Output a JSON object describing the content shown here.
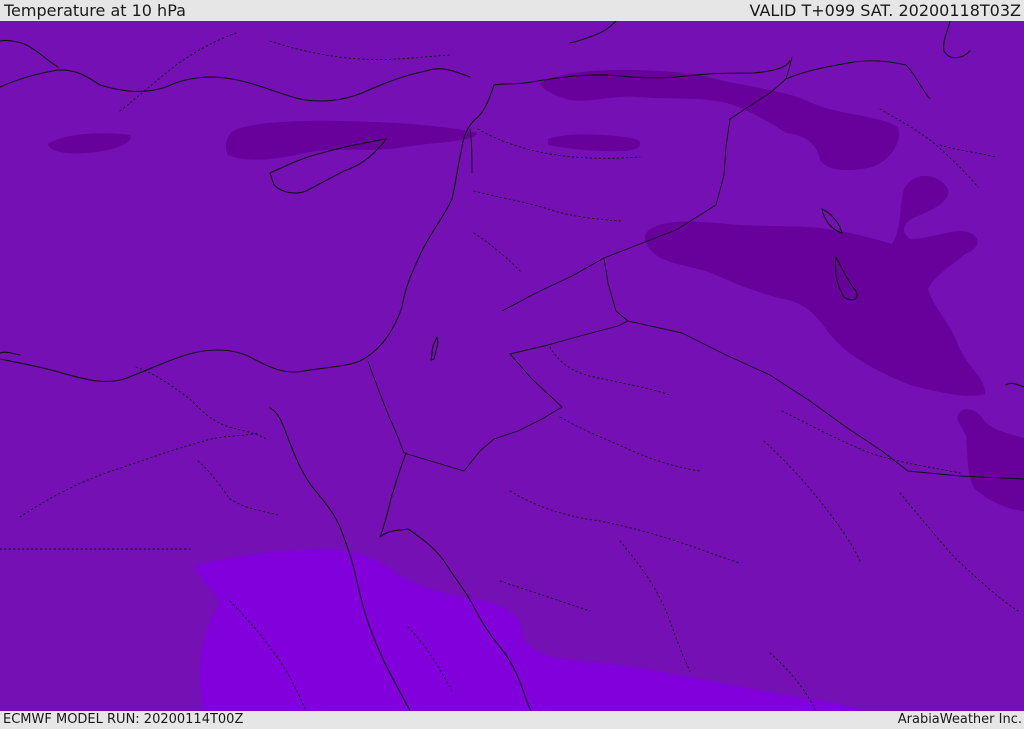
{
  "header": {
    "title": "Temperature at 10 hPa",
    "valid_time": "VALID T+099 SAT. 20200118T03Z"
  },
  "footer": {
    "model_run": "ECMWF MODEL RUN: 20200114T00Z",
    "credit": "ArabiaWeather Inc."
  },
  "map": {
    "colors": {
      "base_fill": "#7510b5",
      "cold_patch": "#68009b",
      "warm_patch": "#8100db",
      "land_lines": "#111111"
    }
  }
}
